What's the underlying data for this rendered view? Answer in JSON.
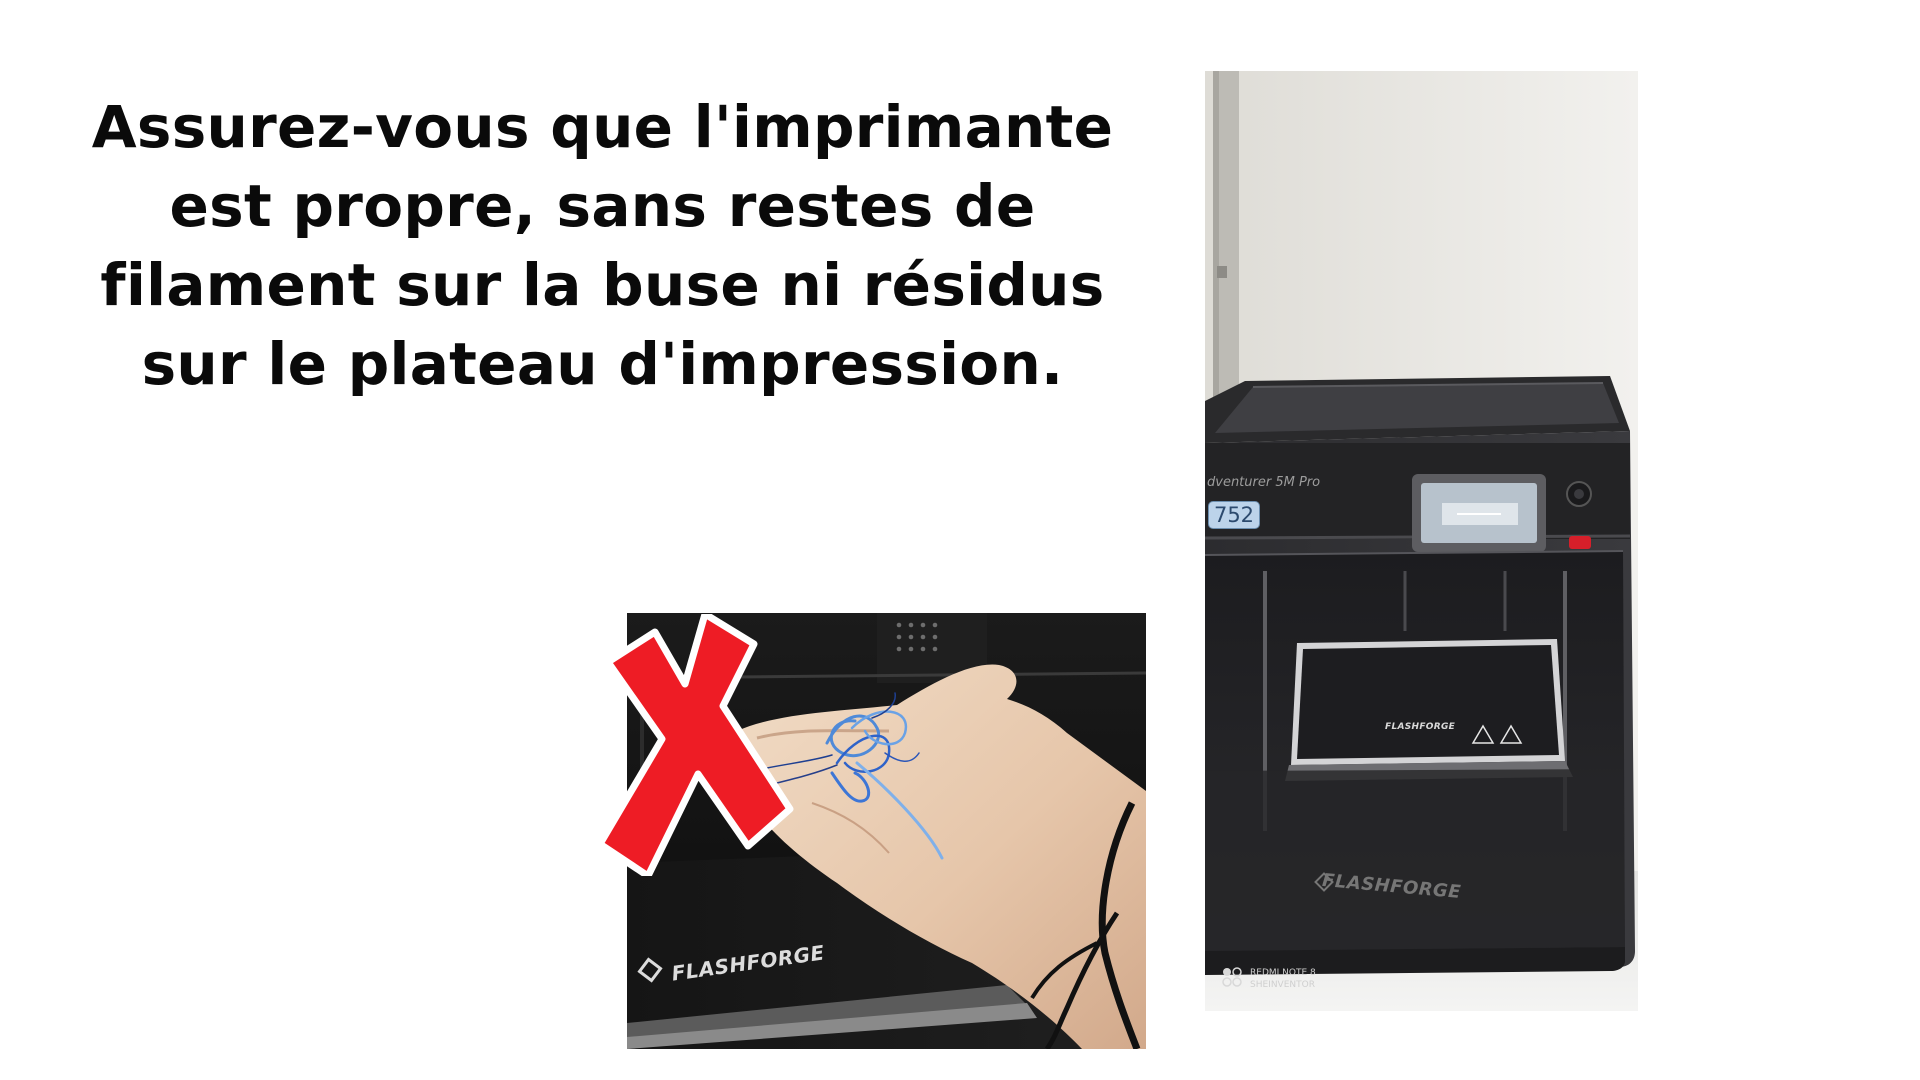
{
  "headline": {
    "lines": [
      "Assurez-vous que l'imprimante",
      "est propre, sans restes de",
      "filament sur la buse ni résidus",
      "sur le plateau d'impression."
    ]
  },
  "photo_hand": {
    "brand_text": "FLASHFORGE",
    "x_mark_color": "#ee1c25"
  },
  "photo_printer": {
    "model_name": "dventurer 5M Pro",
    "model_badge": "752",
    "plate_brand": "FLASHFORGE",
    "front_brand": "FLASHFORGE",
    "watermark_line1": "REDMI NOTE 8",
    "watermark_line2": "SHEINVENTOR"
  }
}
